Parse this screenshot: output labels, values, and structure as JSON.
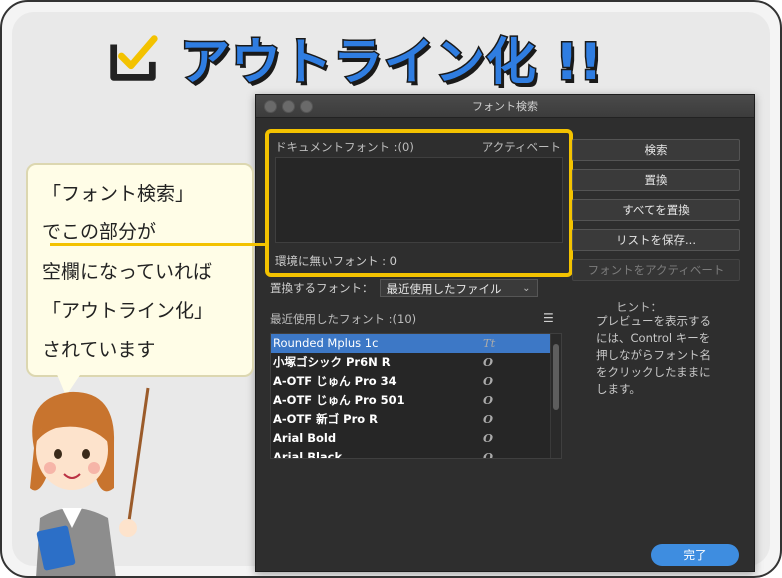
{
  "headline": {
    "title": "アウトライン化 !!",
    "icon": "check-icon"
  },
  "window": {
    "title": "フォント検索"
  },
  "document_fonts": {
    "label": "ドキュメントフォント :(0)",
    "activate_label": "アクティベート",
    "missing_label": "環境に無いフォント : 0"
  },
  "buttons": {
    "find": "検索",
    "replace": "置換",
    "replace_all": "すべてを置換",
    "save_list": "リストを保存...",
    "activate_fonts": "フォントをアクティベート",
    "done": "完了"
  },
  "replace_with": {
    "label": "置換するフォント：",
    "selected": "最近使用したファイル"
  },
  "recent_fonts": {
    "label": "最近使用したフォント :(10)",
    "items": [
      {
        "name": "Rounded Mplus 1c",
        "icon": "Tt"
      },
      {
        "name": "小塚ゴシック Pr6N R",
        "icon": "O"
      },
      {
        "name": "A-OTF じゅん Pro 34",
        "icon": "O"
      },
      {
        "name": "A-OTF じゅん Pro 501",
        "icon": "O"
      },
      {
        "name": "A-OTF 新ゴ Pro R",
        "icon": "O"
      },
      {
        "name": "Arial Bold",
        "icon": "O"
      },
      {
        "name": "Arial Black",
        "icon": "O"
      }
    ]
  },
  "hint": {
    "title": "ヒント：",
    "text": "プレビューを表示するには、Control キーを押しながらフォント名をクリックしたままにします。"
  },
  "callout": {
    "lines": [
      "「フォント検索」",
      "でこの部分が",
      "空欄になっていれば",
      "「アウトライン化」",
      "されています"
    ]
  },
  "colors": {
    "accent": "#f3c200",
    "title_blue": "#2f7de1",
    "done_blue": "#3e8de0",
    "selection": "#3d78c6"
  }
}
